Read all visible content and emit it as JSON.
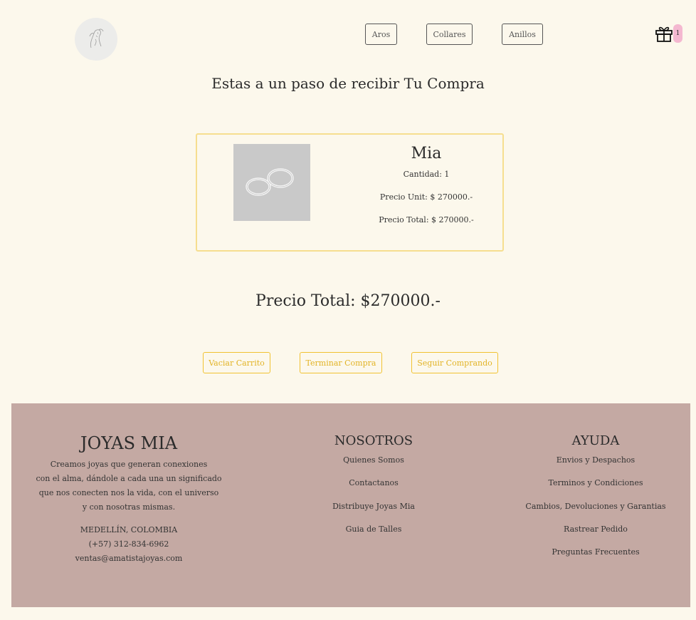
{
  "header": {
    "logo_alt": "logo",
    "nav": [
      {
        "label": "Aros"
      },
      {
        "label": "Collares"
      },
      {
        "label": "Anillos"
      }
    ],
    "cart_count": "1"
  },
  "heading": "Estas a un paso de recibir Tu Compra",
  "cart_items": [
    {
      "name": "Mia",
      "quantity": "Cantidad: 1",
      "unit_price": "Precio Unit: $ 270000.-",
      "total_price": "Precio Total: $ 270000.-"
    }
  ],
  "grand_total": "Precio Total: $270000.-",
  "actions": {
    "empty_cart": "Vaciar Carrito",
    "checkout": "Terminar Compra",
    "continue": "Seguir Comprando"
  },
  "footer": {
    "brand": {
      "title": "JOYAS MIA",
      "description_lines": [
        "Creamos joyas que generan conexiones",
        "con el alma, dándole a cada una un significado",
        "que nos conecten nos la vida, con el universo",
        "y con nosotras mismas."
      ],
      "location": "MEDELLÍN, COLOMBIA",
      "phone": "(+57) 312-834-6962",
      "email": "ventas@amatistajoyas.com"
    },
    "nosotros": {
      "title": "NOSOTROS",
      "links": [
        "Quienes Somos",
        "Contactanos",
        "Distribuye Joyas Mia",
        "Guia de Talles"
      ]
    },
    "ayuda": {
      "title": "AYUDA",
      "links": [
        "Envios y Despachos",
        "Terminos y Condiciones",
        "Cambios, Devoluciones y Garantias",
        "Rastrear Pedido",
        "Preguntas Frecuentes"
      ]
    }
  },
  "colors": {
    "background": "#fcf8ec",
    "accent_yellow": "#f1c232",
    "card_border": "#f6de8f",
    "footer_bg": "#c4a9a3",
    "badge": "#f4b8d0"
  }
}
